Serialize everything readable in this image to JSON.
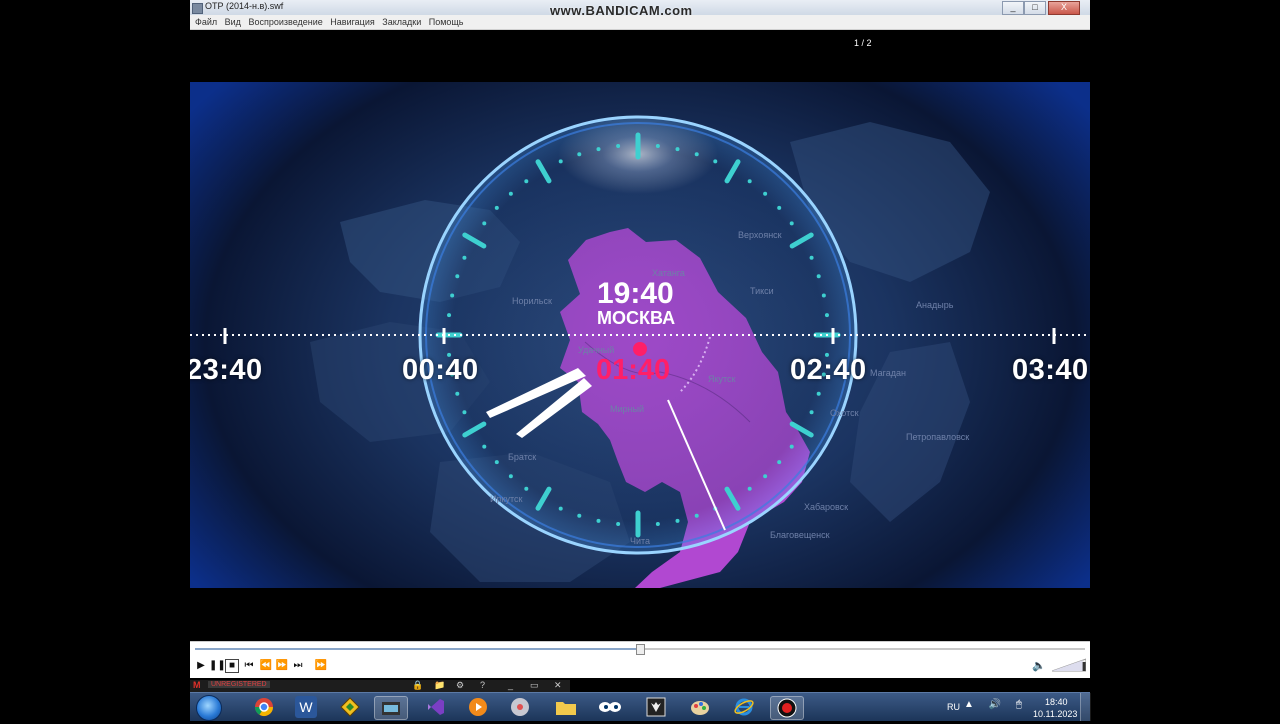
{
  "window": {
    "title": "ОТР (2014-н.в).swf",
    "controls": [
      "_",
      "□",
      "X"
    ]
  },
  "watermark": "www.BANDICAM.com",
  "menu": [
    "Файл",
    "Вид",
    "Воспроизведение",
    "Навигация",
    "Закладки",
    "Помощь"
  ],
  "clock": {
    "moscow_time": "19:40",
    "moscow_label": "МОСКВА",
    "local_time": "01:40",
    "scale_labels": [
      "23:40",
      "00:40",
      "02:40",
      "03:40"
    ]
  },
  "map_labels": [
    "Удачный",
    "Мирный",
    "Якутск",
    "Норильск",
    "Хатанга",
    "Тикси",
    "Верхоянск",
    "Анадырь",
    "Магадан",
    "Петропавловск",
    "Охотск",
    "Благовещенск",
    "Хабаровск",
    "Братск",
    "Иркутск",
    "Чита"
  ],
  "colors": {
    "accent_clock": "#3ed0d0",
    "local_time": "#ff1f68",
    "region": "#b94ad8",
    "map_bg": "#1b3461"
  },
  "player": {
    "buttons": [
      "play-icon",
      "pause-icon",
      "stop-icon",
      "rewind-start-icon",
      "step-back-icon",
      "step-forward-icon",
      "fast-forward-end-icon",
      "next-frame-icon"
    ],
    "seek_fraction": 0.5,
    "volume_fraction": 0.9,
    "page_counter": "1 / 2"
  },
  "recorder": {
    "logo": "M",
    "status": "UNREGISTERED"
  },
  "taskbar": {
    "language": "RU",
    "time": "18:40",
    "date": "10.11.2023",
    "apps": [
      "chrome-icon",
      "word-icon",
      "winamp-icon",
      "movie-icon",
      "visual-studio-icon",
      "media-player-icon",
      "burner-icon",
      "explorer-icon",
      "eyes-icon",
      "wolf-icon",
      "paint-icon",
      "internet-explorer-icon",
      "record-icon"
    ]
  }
}
